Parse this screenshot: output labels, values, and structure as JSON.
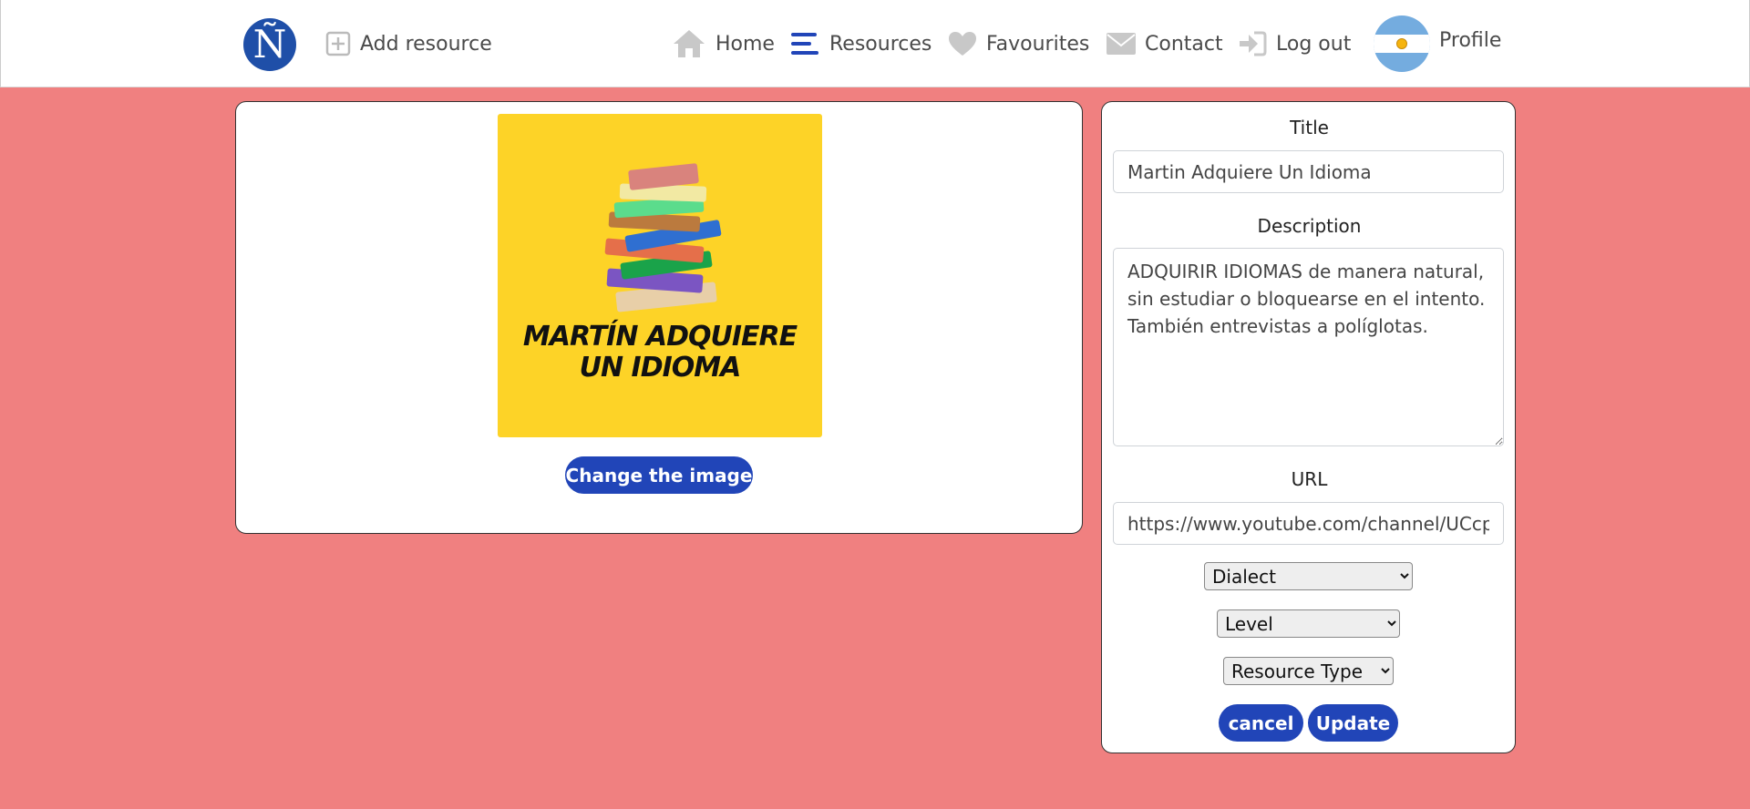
{
  "navbar": {
    "logo_text": "Ñ",
    "add_resource": "Add resource",
    "home": "Home",
    "resources": "Resources",
    "favourites": "Favourites",
    "contact": "Contact",
    "logout": "Log out",
    "profile": "Profile"
  },
  "resource": {
    "image_caption_line1": "MARTÍN ADQUIERE",
    "image_caption_line2": "UN IDIOMA",
    "change_image_label": "Change the image"
  },
  "form": {
    "title_label": "Title",
    "title_value": "Martin Adquiere Un Idioma",
    "description_label": "Description",
    "description_value": "ADQUIRIR IDIOMAS de manera natural, sin estudiar o bloquearse en el intento. También entrevistas a políglotas.",
    "url_label": "URL",
    "url_value": "https://www.youtube.com/channel/UCcp",
    "dialect_selected": "Dialect",
    "level_selected": "Level",
    "resource_type_selected": "Resource Type",
    "cancel_label": "cancel",
    "update_label": "Update"
  },
  "colors": {
    "background": "#f08080",
    "primary_button": "#2145b8",
    "image_background": "#fdd327",
    "logo": "#1f4fa8"
  }
}
